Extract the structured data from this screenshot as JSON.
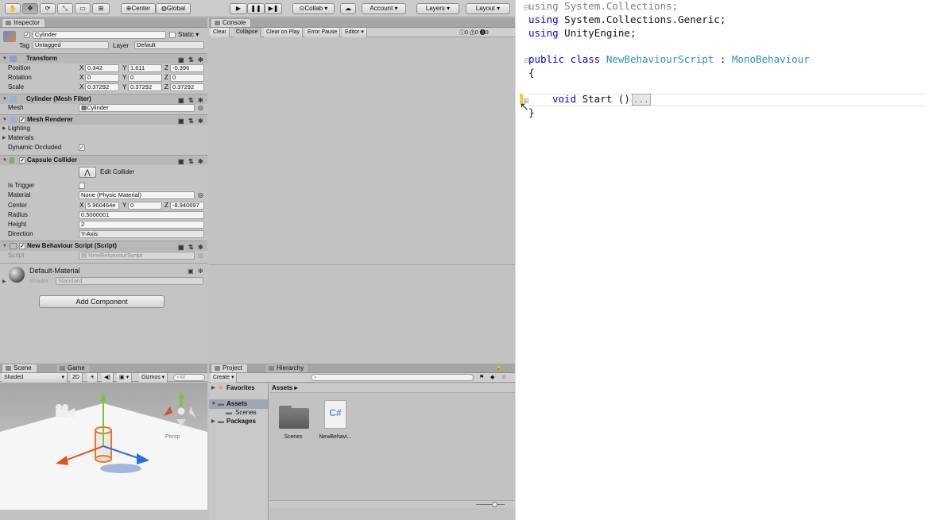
{
  "toolbar": {
    "center": "Center",
    "global": "Global",
    "collab": "Collab",
    "account": "Account",
    "layers": "Layers",
    "layout": "Layout"
  },
  "inspector": {
    "tab": "Inspector",
    "object_name": "Cylinder",
    "static_label": "Static",
    "tag_label": "Tag",
    "tag_value": "Untagged",
    "layer_label": "Layer",
    "layer_value": "Default",
    "transform": {
      "title": "Transform",
      "position": {
        "label": "Position",
        "x": "0.342",
        "y": "1.611",
        "z": "-0.396"
      },
      "rotation": {
        "label": "Rotation",
        "x": "0",
        "y": "0",
        "z": "0"
      },
      "scale": {
        "label": "Scale",
        "x": "0.37292",
        "y": "0.37292",
        "z": "0.37292"
      }
    },
    "mesh_filter": {
      "title": "Cylinder (Mesh Filter)",
      "mesh_label": "Mesh",
      "mesh_value": "Cylinder"
    },
    "mesh_renderer": {
      "title": "Mesh Renderer",
      "lighting": "Lighting",
      "materials": "Materials",
      "dynamic_occluded": "Dynamic Occluded"
    },
    "capsule": {
      "title": "Capsule Collider",
      "edit_collider": "Edit Collider",
      "is_trigger": "Is Trigger",
      "material_label": "Material",
      "material_value": "None (Physic Material)",
      "center_label": "Center",
      "cx": "5.960464e",
      "cy": "0",
      "cz": "-8.940697",
      "radius_label": "Radius",
      "radius_value": "0.5000001",
      "height_label": "Height",
      "height_value": "2",
      "direction_label": "Direction",
      "direction_value": "Y-Axis"
    },
    "script_comp": {
      "title": "New Behaviour Script (Script)",
      "script_label": "Script",
      "script_value": "NewBehaviourScript"
    },
    "material": {
      "name": "Default-Material",
      "shader_label": "Shader",
      "shader_value": "Standard"
    },
    "add_component": "Add Component"
  },
  "console": {
    "tab": "Console",
    "clear": "Clear",
    "collapse": "Collapse",
    "clear_on_play": "Clear on Play",
    "error_pause": "Error Pause",
    "editor": "Editor",
    "count_info": "0",
    "count_warn": "0",
    "count_err": "0"
  },
  "scene": {
    "tab_scene": "Scene",
    "tab_game": "Game",
    "shaded": "Shaded",
    "mode_2d": "2D",
    "gizmos": "Gizmos",
    "search": "All",
    "persp": "Persp"
  },
  "project": {
    "tab_project": "Project",
    "tab_hierarchy": "Hierarchy",
    "create": "Create",
    "favorites": "Favorites",
    "assets": "Assets",
    "scenes": "Scenes",
    "packages": "Packages",
    "breadcrumb": "Assets",
    "items": [
      {
        "label": "Scenes"
      },
      {
        "label": "NewBehavi..."
      }
    ],
    "csharp": "C#"
  },
  "code": {
    "l1": {
      "kw": "using",
      "rest": " System.Collections;"
    },
    "l2": {
      "kw": "using",
      "rest": " System.Collections.Generic;"
    },
    "l3": {
      "kw": "using",
      "rest": " UnityEngine;"
    },
    "l5": {
      "kw1": "public",
      "kw2": " class",
      "name": " NewBehaviourScript",
      "colon": " : ",
      "base": "MonoBehaviour"
    },
    "l6": "{",
    "l8": {
      "kw": "void",
      "rest": " Start ()",
      "fold": "..."
    },
    "l9": "}"
  }
}
